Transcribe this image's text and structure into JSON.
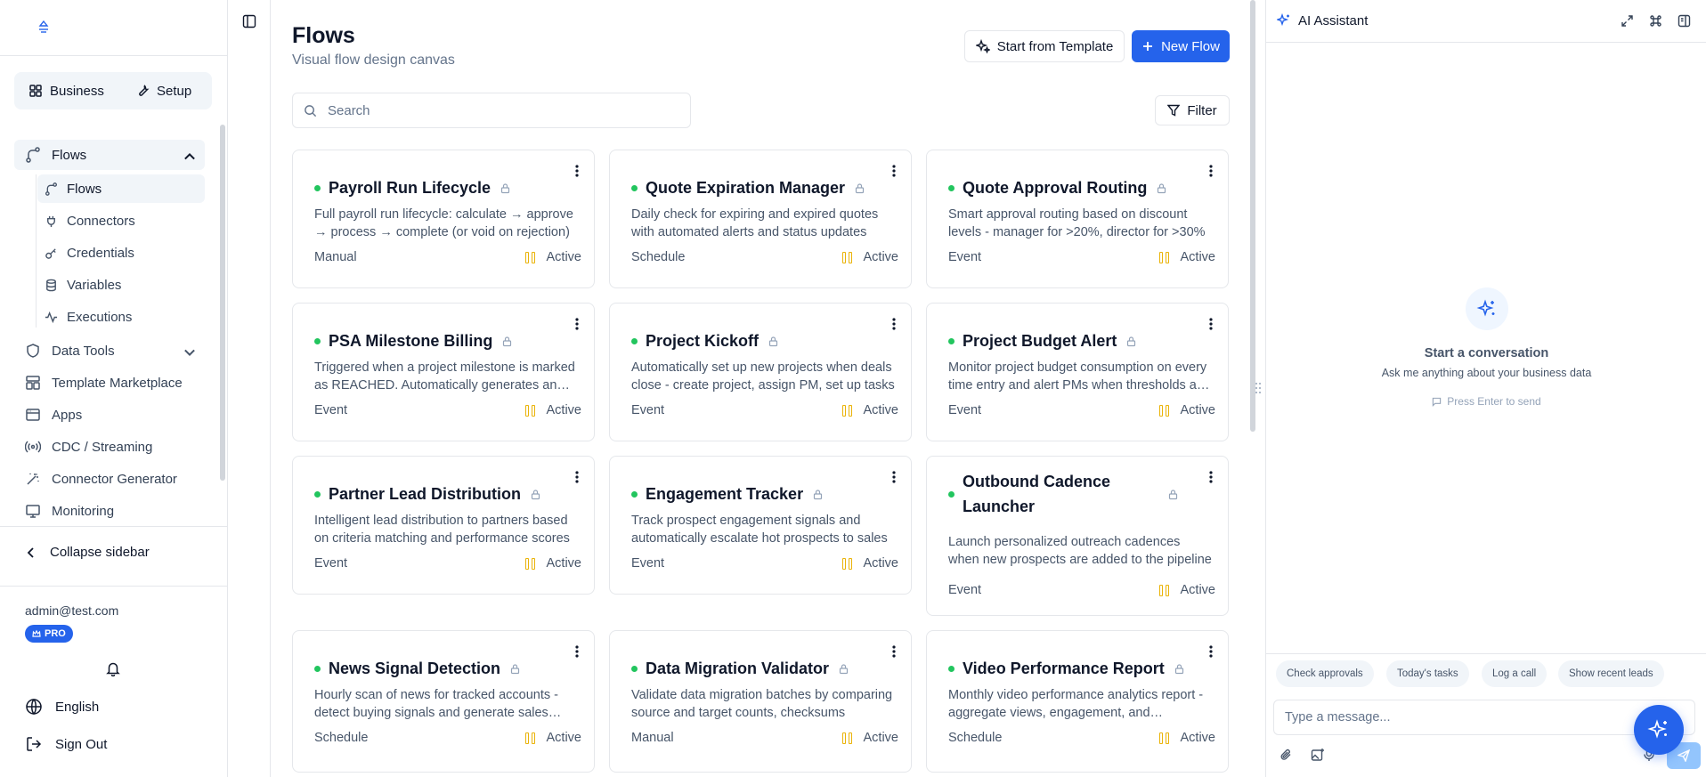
{
  "sidebar": {
    "mode_tabs": [
      {
        "label": "Business",
        "icon": "grid-icon"
      },
      {
        "label": "Setup",
        "icon": "wrench-icon"
      }
    ],
    "flows_group": {
      "label": "Flows",
      "expanded": true,
      "children": [
        {
          "label": "Flows",
          "icon": "flow-icon",
          "active": true
        },
        {
          "label": "Connectors",
          "icon": "plug-icon"
        },
        {
          "label": "Credentials",
          "icon": "key-icon"
        },
        {
          "label": "Variables",
          "icon": "database-icon"
        },
        {
          "label": "Executions",
          "icon": "activity-icon"
        }
      ]
    },
    "items": [
      {
        "label": "Data Tools",
        "icon": "shield-icon",
        "has_chevron": true
      },
      {
        "label": "Template Marketplace",
        "icon": "layout-icon"
      },
      {
        "label": "Apps",
        "icon": "app-window-icon"
      },
      {
        "label": "CDC / Streaming",
        "icon": "radio-icon"
      },
      {
        "label": "Connector Generator",
        "icon": "wand-icon"
      },
      {
        "label": "Monitoring",
        "icon": "monitor-icon"
      }
    ],
    "collapse_label": "Collapse sidebar",
    "user_email": "admin@test.com",
    "plan_badge": "PRO",
    "language": "English",
    "sign_out": "Sign Out"
  },
  "header": {
    "title": "Flows",
    "subtitle": "Visual flow design canvas",
    "template_button": "Start from Template",
    "new_button": "New Flow"
  },
  "search": {
    "placeholder": "Search",
    "value": ""
  },
  "filter_label": "Filter",
  "flows": [
    {
      "title": "Payroll Run Lifecycle",
      "description": "Full payroll run lifecycle: calculate → approve → process → complete (or void on rejection)",
      "trigger": "Manual",
      "status": "Active"
    },
    {
      "title": "Quote Expiration Manager",
      "description": "Daily check for expiring and expired quotes with automated alerts and status updates",
      "trigger": "Schedule",
      "status": "Active"
    },
    {
      "title": "Quote Approval Routing",
      "description": "Smart approval routing based on discount levels - manager for >20%, director for >30%",
      "trigger": "Event",
      "status": "Active"
    },
    {
      "title": "PSA Milestone Billing",
      "description": "Triggered when a project milestone is marked as REACHED. Automatically generates an invoice",
      "trigger": "Event",
      "status": "Active"
    },
    {
      "title": "Project Kickoff",
      "description": "Automatically set up new projects when deals close - create project, assign PM, set up tasks",
      "trigger": "Event",
      "status": "Active"
    },
    {
      "title": "Project Budget Alert",
      "description": "Monitor project budget consumption on every time entry and alert PMs when thresholds are hit",
      "trigger": "Event",
      "status": "Active"
    },
    {
      "title": "Partner Lead Distribution",
      "description": "Intelligent lead distribution to partners based on criteria matching and performance scores",
      "trigger": "Event",
      "status": "Active"
    },
    {
      "title": "Engagement Tracker",
      "description": "Track prospect engagement signals and automatically escalate hot prospects to sales",
      "trigger": "Event",
      "status": "Active"
    },
    {
      "title": "Outbound Cadence Launcher",
      "description": "Launch personalized outreach cadences when new prospects are added to the pipeline",
      "trigger": "Event",
      "status": "Active"
    },
    {
      "title": "News Signal Detection",
      "description": "Hourly scan of news for tracked accounts - detect buying signals and generate sales alerts",
      "trigger": "Schedule",
      "status": "Active"
    },
    {
      "title": "Data Migration Validator",
      "description": "Validate data migration batches by comparing source and target counts, checksums",
      "trigger": "Manual",
      "status": "Active"
    },
    {
      "title": "Video Performance Report",
      "description": "Monthly video performance analytics report - aggregate views, engagement, and conversions",
      "trigger": "Schedule",
      "status": "Active"
    }
  ],
  "ai": {
    "title": "AI Assistant",
    "empty_title": "Start a conversation",
    "empty_subtitle": "Ask me anything about your business data",
    "hint": "Press Enter to send",
    "chips": [
      "Check approvals",
      "Today's tasks",
      "Log a call",
      "Show recent leads"
    ],
    "input_placeholder": "Type a message..."
  },
  "colors": {
    "accent": "#2563eb",
    "status_active": "#22c55e",
    "status_paused": "#eab308"
  }
}
